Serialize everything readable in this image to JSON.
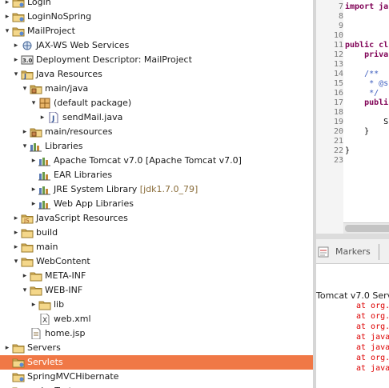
{
  "explorer": {
    "items": [
      {
        "label": "Login",
        "suffix": "",
        "icon": "project-icon",
        "twisty": "▸"
      },
      {
        "label": "LoginNoSpring",
        "suffix": "",
        "icon": "project-icon",
        "twisty": "▸"
      },
      {
        "label": "MailProject",
        "suffix": "",
        "icon": "project-icon",
        "twisty": "▾"
      },
      {
        "label": "JAX-WS Web Services",
        "suffix": "",
        "icon": "webservice-icon",
        "twisty": "▸"
      },
      {
        "label": "Deployment Descriptor: MailProject",
        "suffix": "",
        "icon": "deployment-descriptor-icon",
        "twisty": "▸"
      },
      {
        "label": "Java Resources",
        "suffix": "",
        "icon": "java-resources-icon",
        "twisty": "▾"
      },
      {
        "label": "main/java",
        "suffix": "",
        "icon": "source-folder-icon",
        "twisty": "▾"
      },
      {
        "label": "(default package)",
        "suffix": "",
        "icon": "package-icon",
        "twisty": "▾"
      },
      {
        "label": "sendMail.java",
        "suffix": "",
        "icon": "java-file-icon",
        "twisty": "▸"
      },
      {
        "label": "main/resources",
        "suffix": "",
        "icon": "source-folder-icon",
        "twisty": "▸"
      },
      {
        "label": "Libraries",
        "suffix": "",
        "icon": "libraries-icon",
        "twisty": "▾"
      },
      {
        "label": "Apache Tomcat v7.0 [Apache Tomcat v7.0]",
        "suffix": "",
        "icon": "library-icon",
        "twisty": "▸"
      },
      {
        "label": "EAR Libraries",
        "suffix": "",
        "icon": "library-icon",
        "twisty": ""
      },
      {
        "label": "JRE System Library",
        "suffix": "[jdk1.7.0_79]",
        "icon": "library-icon",
        "twisty": "▸"
      },
      {
        "label": "Web App Libraries",
        "suffix": "",
        "icon": "library-icon",
        "twisty": "▸"
      },
      {
        "label": "JavaScript Resources",
        "suffix": "",
        "icon": "javascript-resources-icon",
        "twisty": "▸"
      },
      {
        "label": "build",
        "suffix": "",
        "icon": "folder-icon",
        "twisty": "▸"
      },
      {
        "label": "main",
        "suffix": "",
        "icon": "folder-icon",
        "twisty": "▸"
      },
      {
        "label": "WebContent",
        "suffix": "",
        "icon": "folder-icon",
        "twisty": "▾"
      },
      {
        "label": "META-INF",
        "suffix": "",
        "icon": "folder-icon",
        "twisty": "▸"
      },
      {
        "label": "WEB-INF",
        "suffix": "",
        "icon": "folder-icon",
        "twisty": "▾"
      },
      {
        "label": "lib",
        "suffix": "",
        "icon": "folder-icon",
        "twisty": "▸"
      },
      {
        "label": "web.xml",
        "suffix": "",
        "icon": "xml-file-icon",
        "twisty": ""
      },
      {
        "label": "home.jsp",
        "suffix": "",
        "icon": "jsp-file-icon",
        "twisty": ""
      },
      {
        "label": "Servers",
        "suffix": "",
        "icon": "folder-icon",
        "twisty": "▸"
      },
      {
        "label": "Servlets",
        "suffix": "",
        "icon": "project-icon",
        "twisty": "",
        "selected": true
      },
      {
        "label": "SpringMVCHibernate",
        "suffix": "",
        "icon": "project-icon",
        "twisty": ""
      },
      {
        "label": "springTest",
        "suffix": "",
        "icon": "project-icon",
        "twisty": ""
      }
    ]
  },
  "editor": {
    "lines": [
      {
        "num": "7",
        "text": "import ja"
      },
      {
        "num": "8",
        "text": ""
      },
      {
        "num": "9",
        "text": ""
      },
      {
        "num": "10",
        "text": ""
      },
      {
        "num": "11",
        "text": "public cl"
      },
      {
        "num": "12",
        "text": "    priva"
      },
      {
        "num": "13",
        "text": ""
      },
      {
        "num": "14",
        "text": "    /**"
      },
      {
        "num": "15",
        "text": "     * @s"
      },
      {
        "num": "16",
        "text": "     */"
      },
      {
        "num": "17",
        "text": "    publi"
      },
      {
        "num": "18",
        "text": ""
      },
      {
        "num": "19",
        "text": "        S"
      },
      {
        "num": "20",
        "text": "    }"
      },
      {
        "num": "21",
        "text": ""
      },
      {
        "num": "22",
        "text": "}"
      },
      {
        "num": "23",
        "text": ""
      }
    ]
  },
  "bottom_panel": {
    "tab_label": "Markers",
    "console_title": "Tomcat v7.0 Serve",
    "trace_lines": [
      "at org.",
      "at org.",
      "at org.",
      "at java",
      "at java",
      "at org.",
      "at java"
    ]
  }
}
